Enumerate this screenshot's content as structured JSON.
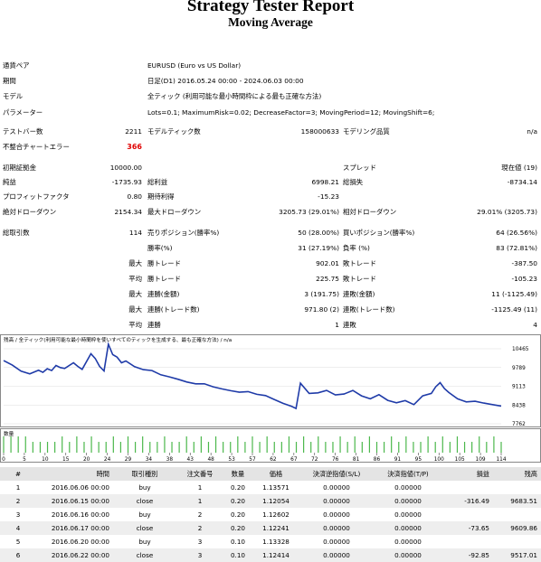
{
  "header": {
    "title": "Strategy Tester Report",
    "subtitle": "Moving Average"
  },
  "settings": [
    {
      "label": "通貨ペア",
      "value": "EURUSD (Euro vs US Dollar)"
    },
    {
      "label": "期間",
      "value": "日足(D1) 2016.05.24 00:00 - 2024.06.03 00:00"
    },
    {
      "label": "モデル",
      "value": "全ティック (利用可能な最小時間枠による最も正確な方法)"
    },
    {
      "label": "パラメーター",
      "value": "Lots=0.1; MaximumRisk=0.02; DecreaseFactor=3; MovingPeriod=12; MovingShift=6;"
    }
  ],
  "bars_row": {
    "bars_label": "テストバー数",
    "bars_value": "2211",
    "ticks_label": "モデルティック数",
    "ticks_value": "158000633",
    "quality_label": "モデリング品質",
    "quality_value": "n/a"
  },
  "mismatch_row": {
    "label": "不整合チャートエラー",
    "value": "366"
  },
  "stats_block": {
    "deposit_label": "初期証拠金",
    "deposit_value": "10000.00",
    "spread_label": "スプレッド",
    "spread_value": "現在値 (19)",
    "net_label": "純益",
    "net_value": "-1735.93",
    "gross_profit_label": "総利益",
    "gross_profit_value": "6998.21",
    "gross_loss_label": "総損失",
    "gross_loss_value": "-8734.14",
    "pf_label": "プロフィットファクタ",
    "pf_value": "0.80",
    "expected_label": "期待利得",
    "expected_value": "-15.23",
    "abs_dd_label": "絶対ドローダウン",
    "abs_dd_value": "2154.34",
    "max_dd_label": "最大ドローダウン",
    "max_dd_value": "3205.73 (29.01%)",
    "rel_dd_label": "相対ドローダウン",
    "rel_dd_value": "29.01% (3205.73)"
  },
  "trades_block": {
    "total_label": "総取引数",
    "total_value": "114",
    "short_label": "売りポジション(勝率%)",
    "short_value": "50 (28.00%)",
    "long_label": "買いポジション(勝率%)",
    "long_value": "64 (26.56%)",
    "winrate_label": "勝率(%)",
    "winrate_value": "31 (27.19%)",
    "lossrate_label": "負率 (%)",
    "lossrate_value": "83 (72.81%)",
    "max_word": "最大",
    "avg_word": "平均",
    "win_trade_label": "勝トレード",
    "max_win_value": "902.01",
    "avg_win_value": "225.75",
    "loss_trade_label": "敗トレード",
    "max_loss_value": "-387.50",
    "avg_loss_value": "-105.23",
    "consec_win_amt_label": "連勝(金額)",
    "consec_win_amt_value": "3 (191.75)",
    "consec_loss_amt_label": "連敗(金額)",
    "consec_loss_amt_value": "11 (-1125.49)",
    "consec_win_cnt_label": "連勝(トレード数)",
    "consec_win_cnt_value": "971.80 (2)",
    "consec_loss_cnt_label": "連敗(トレード数)",
    "consec_loss_cnt_value": "-1125.49 (11)",
    "avg_win_streak_label": "連勝",
    "avg_win_streak_value": "1",
    "avg_loss_streak_label": "連敗",
    "avg_loss_streak_value": "4"
  },
  "chart_data": {
    "type": "line",
    "title": "残高 / 全ティック(利用可能な最小時間枠を使いすべてのティックを生成する、最も正確な方法) / n/a",
    "volume_label": "数量",
    "y_ticks": [
      "10465",
      "9789",
      "9113",
      "8438",
      "7762"
    ],
    "ylim": [
      7762,
      10465
    ],
    "x_ticks": [
      "0",
      "5",
      "10",
      "15",
      "20",
      "24",
      "29",
      "34",
      "38",
      "43",
      "48",
      "53",
      "57",
      "62",
      "67",
      "72",
      "76",
      "81",
      "86",
      "91",
      "95",
      "100",
      "105",
      "109",
      "114"
    ],
    "x": [
      0,
      2,
      4,
      6,
      8,
      9,
      10,
      11,
      12,
      13,
      14,
      16,
      17,
      18,
      20,
      21,
      22,
      23,
      24,
      25,
      26,
      27,
      28,
      30,
      32,
      34,
      36,
      38,
      40,
      42,
      44,
      46,
      48,
      50,
      52,
      54,
      56,
      58,
      60,
      62,
      64,
      66,
      67,
      68,
      70,
      72,
      74,
      76,
      78,
      80,
      82,
      84,
      86,
      88,
      90,
      92,
      94,
      96,
      98,
      99,
      100,
      101,
      102,
      104,
      106,
      108,
      110,
      112,
      114
    ],
    "balance": [
      9920,
      9770,
      9570,
      9480,
      9600,
      9530,
      9650,
      9590,
      9760,
      9690,
      9660,
      9850,
      9730,
      9630,
      10150,
      9990,
      9730,
      9580,
      10465,
      10120,
      10040,
      9850,
      9910,
      9720,
      9620,
      9590,
      9450,
      9380,
      9300,
      9210,
      9150,
      9150,
      9050,
      8980,
      8920,
      8870,
      8890,
      8800,
      8760,
      8630,
      8500,
      8400,
      8330,
      9170,
      8830,
      8850,
      8930,
      8780,
      8810,
      8930,
      8750,
      8650,
      8790,
      8600,
      8520,
      8590,
      8460,
      8750,
      8830,
      9050,
      9190,
      8990,
      8860,
      8650,
      8550,
      8570,
      8510,
      8460,
      8410
    ],
    "volume": [
      0.2,
      0.2,
      0.2,
      0.2,
      0.1,
      0.1,
      0.1,
      0.1,
      0.2,
      0.1,
      0.2,
      0.1,
      0.2,
      0.1,
      0.1,
      0.2,
      0.1,
      0.2,
      0.1,
      0.2,
      0.1,
      0.1,
      0.2,
      0.1,
      0.1,
      0.2,
      0.1,
      0.2,
      0.1,
      0.2,
      0.1,
      0.1,
      0.2,
      0.1,
      0.2,
      0.1,
      0.2,
      0.1,
      0.1,
      0.2,
      0.1,
      0.2,
      0.1,
      0.2,
      0.1,
      0.1,
      0.2,
      0.1,
      0.2,
      0.1,
      0.2,
      0.1,
      0.1,
      0.2,
      0.1,
      0.2,
      0.1,
      0.1,
      0.2,
      0.1,
      0.2,
      0.1,
      0.2,
      0.1,
      0.1,
      0.2,
      0.1,
      0.2,
      0.1
    ],
    "line_color": "#1f3ba8",
    "volume_color": "#4cb84c"
  },
  "table": {
    "headers": [
      "#",
      "時間",
      "取引種別",
      "注文番号",
      "数量",
      "価格",
      "決済逆指値(S/L)",
      "決済指値(T/P)",
      "損益",
      "残高"
    ],
    "rows": [
      [
        "1",
        "2016.06.06 00:00",
        "buy",
        "1",
        "0.20",
        "1.13571",
        "0.00000",
        "0.00000",
        "",
        ""
      ],
      [
        "2",
        "2016.06.15 00:00",
        "close",
        "1",
        "0.20",
        "1.12054",
        "0.00000",
        "0.00000",
        "-316.49",
        "9683.51"
      ],
      [
        "3",
        "2016.06.16 00:00",
        "buy",
        "2",
        "0.20",
        "1.12602",
        "0.00000",
        "0.00000",
        "",
        ""
      ],
      [
        "4",
        "2016.06.17 00:00",
        "close",
        "2",
        "0.20",
        "1.12241",
        "0.00000",
        "0.00000",
        "-73.65",
        "9609.86"
      ],
      [
        "5",
        "2016.06.20 00:00",
        "buy",
        "3",
        "0.10",
        "1.13328",
        "0.00000",
        "0.00000",
        "",
        ""
      ],
      [
        "6",
        "2016.06.22 00:00",
        "close",
        "3",
        "0.10",
        "1.12414",
        "0.00000",
        "0.00000",
        "-92.85",
        "9517.01"
      ]
    ]
  }
}
